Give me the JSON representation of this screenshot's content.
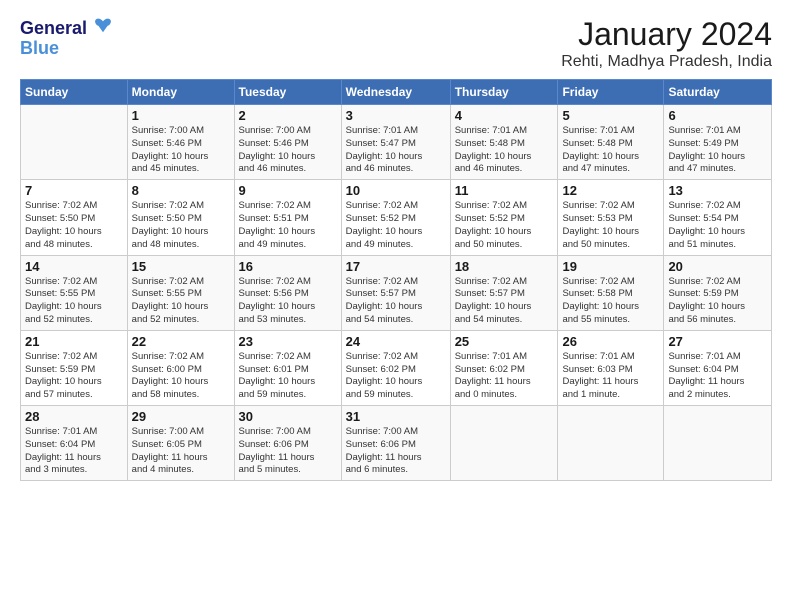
{
  "logo": {
    "line1": "General",
    "line2": "Blue"
  },
  "title": "January 2024",
  "subtitle": "Rehti, Madhya Pradesh, India",
  "weekdays": [
    "Sunday",
    "Monday",
    "Tuesday",
    "Wednesday",
    "Thursday",
    "Friday",
    "Saturday"
  ],
  "weeks": [
    [
      {
        "day": "",
        "info": ""
      },
      {
        "day": "1",
        "info": "Sunrise: 7:00 AM\nSunset: 5:46 PM\nDaylight: 10 hours\nand 45 minutes."
      },
      {
        "day": "2",
        "info": "Sunrise: 7:00 AM\nSunset: 5:46 PM\nDaylight: 10 hours\nand 46 minutes."
      },
      {
        "day": "3",
        "info": "Sunrise: 7:01 AM\nSunset: 5:47 PM\nDaylight: 10 hours\nand 46 minutes."
      },
      {
        "day": "4",
        "info": "Sunrise: 7:01 AM\nSunset: 5:48 PM\nDaylight: 10 hours\nand 46 minutes."
      },
      {
        "day": "5",
        "info": "Sunrise: 7:01 AM\nSunset: 5:48 PM\nDaylight: 10 hours\nand 47 minutes."
      },
      {
        "day": "6",
        "info": "Sunrise: 7:01 AM\nSunset: 5:49 PM\nDaylight: 10 hours\nand 47 minutes."
      }
    ],
    [
      {
        "day": "7",
        "info": "Sunrise: 7:02 AM\nSunset: 5:50 PM\nDaylight: 10 hours\nand 48 minutes."
      },
      {
        "day": "8",
        "info": "Sunrise: 7:02 AM\nSunset: 5:50 PM\nDaylight: 10 hours\nand 48 minutes."
      },
      {
        "day": "9",
        "info": "Sunrise: 7:02 AM\nSunset: 5:51 PM\nDaylight: 10 hours\nand 49 minutes."
      },
      {
        "day": "10",
        "info": "Sunrise: 7:02 AM\nSunset: 5:52 PM\nDaylight: 10 hours\nand 49 minutes."
      },
      {
        "day": "11",
        "info": "Sunrise: 7:02 AM\nSunset: 5:52 PM\nDaylight: 10 hours\nand 50 minutes."
      },
      {
        "day": "12",
        "info": "Sunrise: 7:02 AM\nSunset: 5:53 PM\nDaylight: 10 hours\nand 50 minutes."
      },
      {
        "day": "13",
        "info": "Sunrise: 7:02 AM\nSunset: 5:54 PM\nDaylight: 10 hours\nand 51 minutes."
      }
    ],
    [
      {
        "day": "14",
        "info": "Sunrise: 7:02 AM\nSunset: 5:55 PM\nDaylight: 10 hours\nand 52 minutes."
      },
      {
        "day": "15",
        "info": "Sunrise: 7:02 AM\nSunset: 5:55 PM\nDaylight: 10 hours\nand 52 minutes."
      },
      {
        "day": "16",
        "info": "Sunrise: 7:02 AM\nSunset: 5:56 PM\nDaylight: 10 hours\nand 53 minutes."
      },
      {
        "day": "17",
        "info": "Sunrise: 7:02 AM\nSunset: 5:57 PM\nDaylight: 10 hours\nand 54 minutes."
      },
      {
        "day": "18",
        "info": "Sunrise: 7:02 AM\nSunset: 5:57 PM\nDaylight: 10 hours\nand 54 minutes."
      },
      {
        "day": "19",
        "info": "Sunrise: 7:02 AM\nSunset: 5:58 PM\nDaylight: 10 hours\nand 55 minutes."
      },
      {
        "day": "20",
        "info": "Sunrise: 7:02 AM\nSunset: 5:59 PM\nDaylight: 10 hours\nand 56 minutes."
      }
    ],
    [
      {
        "day": "21",
        "info": "Sunrise: 7:02 AM\nSunset: 5:59 PM\nDaylight: 10 hours\nand 57 minutes."
      },
      {
        "day": "22",
        "info": "Sunrise: 7:02 AM\nSunset: 6:00 PM\nDaylight: 10 hours\nand 58 minutes."
      },
      {
        "day": "23",
        "info": "Sunrise: 7:02 AM\nSunset: 6:01 PM\nDaylight: 10 hours\nand 59 minutes."
      },
      {
        "day": "24",
        "info": "Sunrise: 7:02 AM\nSunset: 6:02 PM\nDaylight: 10 hours\nand 59 minutes."
      },
      {
        "day": "25",
        "info": "Sunrise: 7:01 AM\nSunset: 6:02 PM\nDaylight: 11 hours\nand 0 minutes."
      },
      {
        "day": "26",
        "info": "Sunrise: 7:01 AM\nSunset: 6:03 PM\nDaylight: 11 hours\nand 1 minute."
      },
      {
        "day": "27",
        "info": "Sunrise: 7:01 AM\nSunset: 6:04 PM\nDaylight: 11 hours\nand 2 minutes."
      }
    ],
    [
      {
        "day": "28",
        "info": "Sunrise: 7:01 AM\nSunset: 6:04 PM\nDaylight: 11 hours\nand 3 minutes."
      },
      {
        "day": "29",
        "info": "Sunrise: 7:00 AM\nSunset: 6:05 PM\nDaylight: 11 hours\nand 4 minutes."
      },
      {
        "day": "30",
        "info": "Sunrise: 7:00 AM\nSunset: 6:06 PM\nDaylight: 11 hours\nand 5 minutes."
      },
      {
        "day": "31",
        "info": "Sunrise: 7:00 AM\nSunset: 6:06 PM\nDaylight: 11 hours\nand 6 minutes."
      },
      {
        "day": "",
        "info": ""
      },
      {
        "day": "",
        "info": ""
      },
      {
        "day": "",
        "info": ""
      }
    ]
  ]
}
